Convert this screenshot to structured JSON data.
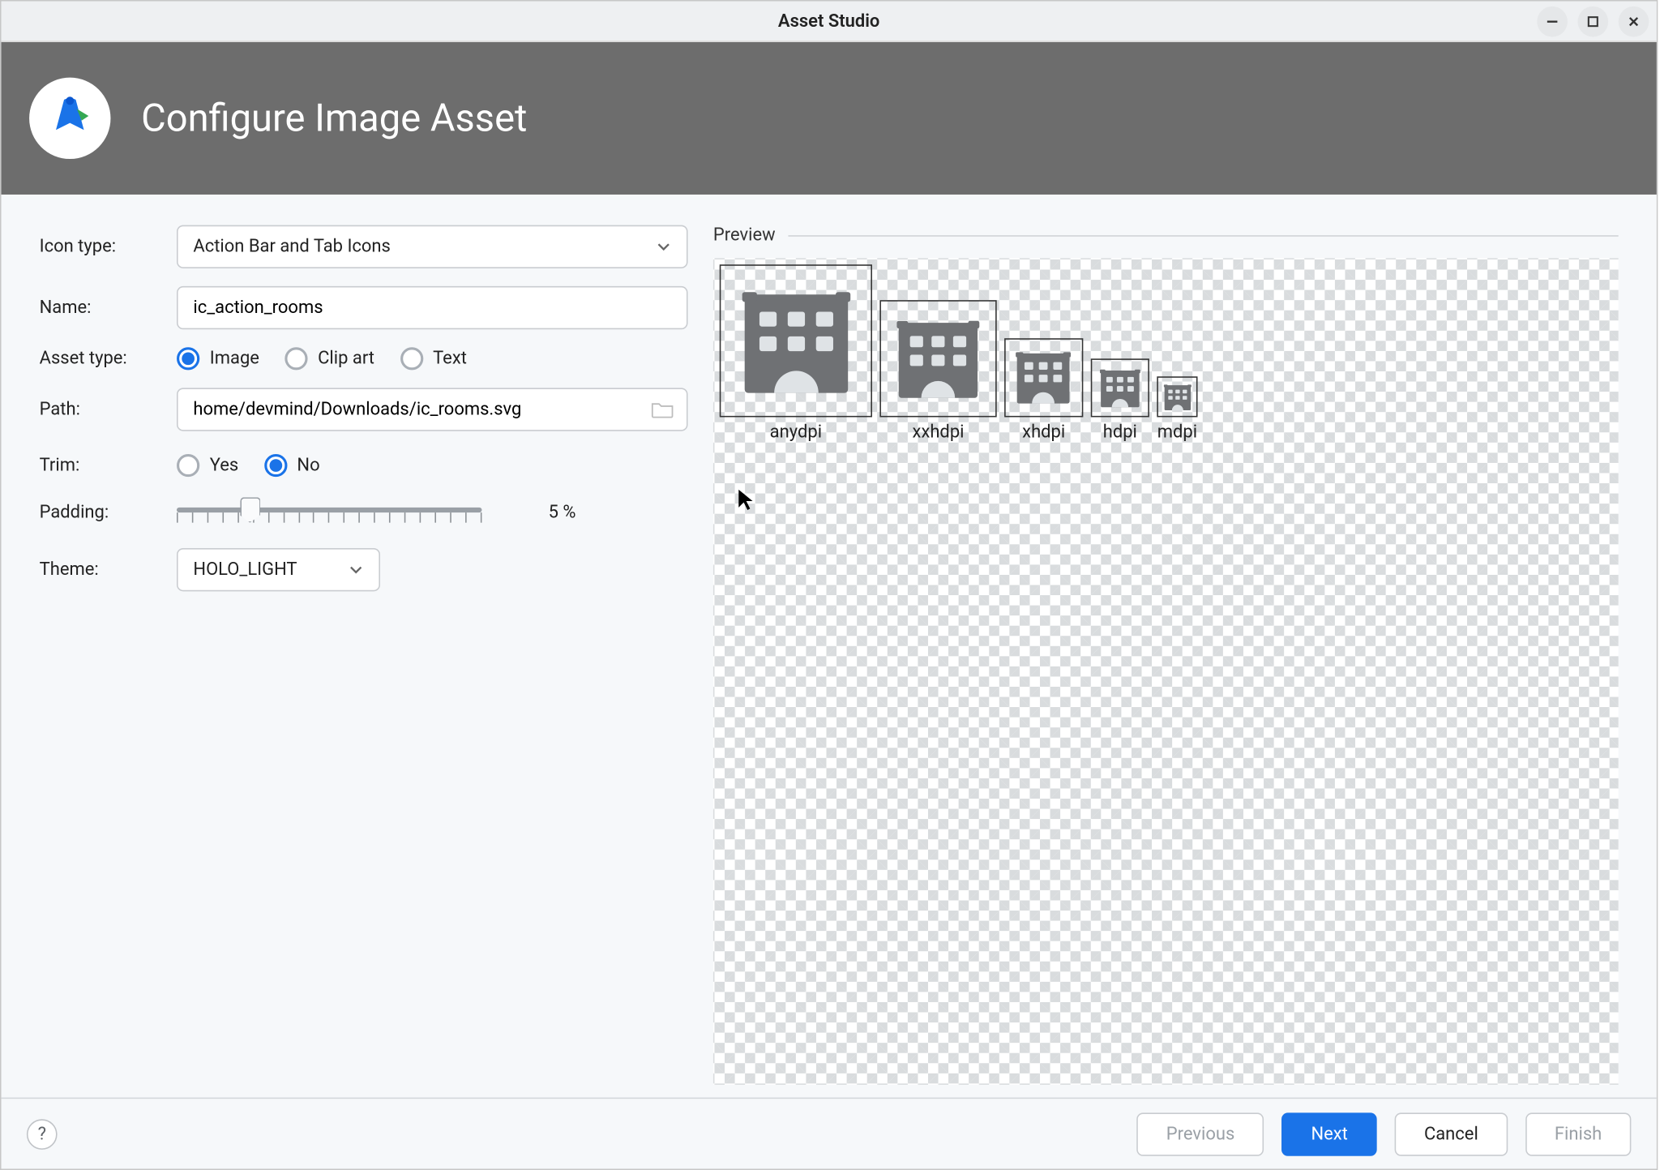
{
  "window": {
    "title": "Asset Studio"
  },
  "banner": {
    "heading": "Configure Image Asset"
  },
  "labels": {
    "icon_type": "Icon type:",
    "name": "Name:",
    "asset_type": "Asset type:",
    "path": "Path:",
    "trim": "Trim:",
    "padding": "Padding:",
    "theme": "Theme:",
    "preview": "Preview"
  },
  "form": {
    "icon_type_value": "Action Bar and Tab Icons",
    "name_value": "ic_action_rooms",
    "asset_type_options": [
      "Image",
      "Clip art",
      "Text"
    ],
    "asset_type_selected": "Image",
    "path_value": "home/devmind/Downloads/ic_rooms.svg",
    "trim_options": [
      "Yes",
      "No"
    ],
    "trim_selected": "No",
    "padding_value": "5 %",
    "padding_fraction": 0.24,
    "theme_value": "HOLO_LIGHT"
  },
  "preview": {
    "items": [
      {
        "label": "anydpi",
        "size": 120
      },
      {
        "label": "xxhdpi",
        "size": 92
      },
      {
        "label": "xhdpi",
        "size": 62
      },
      {
        "label": "hdpi",
        "size": 46
      },
      {
        "label": "mdpi",
        "size": 32
      }
    ]
  },
  "buttons": {
    "help": "?",
    "previous": "Previous",
    "next": "Next",
    "cancel": "Cancel",
    "finish": "Finish"
  },
  "colors": {
    "accent": "#1a73e8",
    "banner_bg": "#6d6d6d",
    "icon_grey": "#6f7174"
  }
}
